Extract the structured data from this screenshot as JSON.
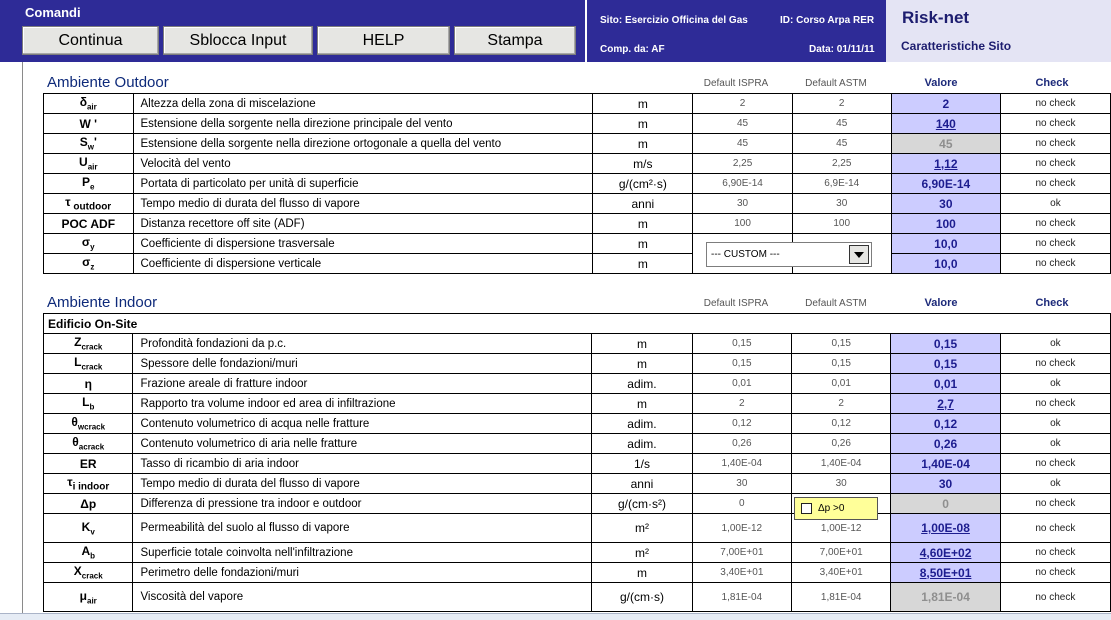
{
  "header": {
    "title": "Comandi",
    "buttons": {
      "continua": "Continua",
      "sblocca": "Sblocca Input",
      "help": "HELP",
      "stampa": "Stampa"
    },
    "site": "Sito: Esercizio Officina del Gas",
    "id": "ID: Corso Arpa RER",
    "comp": "Comp. da: AF",
    "date": "Data: 01/11/11",
    "brand": "Risk-net",
    "subtitle": "Caratteristiche Sito"
  },
  "columns": {
    "isp": "Default ISPRA",
    "astm": "Default ASTM",
    "val": "Valore",
    "chk": "Check"
  },
  "outdoor": {
    "title": "Ambiente Outdoor",
    "rows": [
      {
        "sym": "δair",
        "desc": "Altezza della zona di miscelazione",
        "unit": "m",
        "isp": "2",
        "astm": "2",
        "val": "2",
        "chk": "no check"
      },
      {
        "sym": "W '",
        "desc": "Estensione della sorgente nella direzione principale del vento",
        "unit": "m",
        "isp": "45",
        "astm": "45",
        "val": "140",
        "chk": "no check"
      },
      {
        "sym": "Sw'",
        "desc": "Estensione della sorgente nella direzione ortogonale a quella del vento",
        "unit": "m",
        "isp": "45",
        "astm": "45",
        "val": "45",
        "chk": "no check"
      },
      {
        "sym": "Uair",
        "desc": "Velocità del vento",
        "unit": "m/s",
        "isp": "2,25",
        "astm": "2,25",
        "val": "1,12",
        "chk": "no check"
      },
      {
        "sym": "Pe",
        "desc": "Portata di particolato per unità di superficie",
        "unit": "g/(cm²·s)",
        "isp": "6,90E-14",
        "astm": "6,9E-14",
        "val": "6,90E-14",
        "chk": "no check"
      },
      {
        "sym": "τ outdoor",
        "desc": "Tempo medio di durata del flusso di vapore",
        "unit": "anni",
        "isp": "30",
        "astm": "30",
        "val": "30",
        "chk": "ok"
      },
      {
        "sym": "POC ADF",
        "desc": "Distanza recettore off site (ADF)",
        "unit": "m",
        "isp": "100",
        "astm": "100",
        "val": "100",
        "chk": "no check"
      },
      {
        "sym": "σy",
        "desc": "Coefficiente di dispersione trasversale",
        "unit": "m",
        "isp": "",
        "astm": "",
        "val": "10,0",
        "chk": "no check"
      },
      {
        "sym": "σz",
        "desc": "Coefficiente di dispersione verticale",
        "unit": "m",
        "isp": "",
        "astm": "",
        "val": "10,0",
        "chk": "no check"
      }
    ],
    "dropdown": "--- CUSTOM ---"
  },
  "indoor": {
    "title": "Ambiente Indoor",
    "subheader": "Edificio On-Site",
    "rows": [
      {
        "sym": "Zcrack",
        "desc": "Profondità fondazioni da p.c.",
        "unit": "m",
        "isp": "0,15",
        "astm": "0,15",
        "val": "0,15",
        "chk": "ok"
      },
      {
        "sym": "Lcrack",
        "desc": "Spessore delle fondazioni/muri",
        "unit": "m",
        "isp": "0,15",
        "astm": "0,15",
        "val": "0,15",
        "chk": "no check"
      },
      {
        "sym": "η",
        "desc": "Frazione areale di fratture indoor",
        "unit": "adim.",
        "isp": "0,01",
        "astm": "0,01",
        "val": "0,01",
        "chk": "ok"
      },
      {
        "sym": "Lb",
        "desc": "Rapporto tra volume indoor ed area di infiltrazione",
        "unit": "m",
        "isp": "2",
        "astm": "2",
        "val": "2,7",
        "chk": "no check"
      },
      {
        "sym": "θwcrack",
        "desc": "Contenuto volumetrico di acqua nelle fratture",
        "unit": "adim.",
        "isp": "0,12",
        "astm": "0,12",
        "val": "0,12",
        "chk": "ok"
      },
      {
        "sym": "θacrack",
        "desc": "Contenuto volumetrico di aria nelle fratture",
        "unit": "adim.",
        "isp": "0,26",
        "astm": "0,26",
        "val": "0,26",
        "chk": "ok"
      },
      {
        "sym": "ER",
        "desc": "Tasso di ricambio di aria indoor",
        "unit": "1/s",
        "isp": "1,40E-04",
        "astm": "1,40E-04",
        "val": "1,40E-04",
        "chk": "no check"
      },
      {
        "sym": "τi indoor",
        "desc": "Tempo medio di durata del flusso di vapore",
        "unit": "anni",
        "isp": "30",
        "astm": "30",
        "val": "30",
        "chk": "ok"
      },
      {
        "sym": "Δp",
        "desc": "Differenza di pressione tra indoor e outdoor",
        "unit": "g/(cm·s²)",
        "isp": "0",
        "astm": "",
        "val": "0",
        "chk": "no check"
      },
      {
        "sym": "Kv",
        "desc": "Permeabilità del suolo al flusso di vapore",
        "unit": "m²",
        "isp": "1,00E-12",
        "astm": "1,00E-12",
        "val": "1,00E-08",
        "chk": "no check"
      },
      {
        "sym": "Ab",
        "desc": "Superficie totale coinvolta nell'infiltrazione",
        "unit": "m²",
        "isp": "7,00E+01",
        "astm": "7,00E+01",
        "val": "4,60E+02",
        "chk": "no check"
      },
      {
        "sym": "Xcrack",
        "desc": "Perimetro delle fondazioni/muri",
        "unit": "m",
        "isp": "3,40E+01",
        "astm": "3,40E+01",
        "val": "8,50E+01",
        "chk": "no check"
      },
      {
        "sym": "μair",
        "desc": "Viscosità del vapore",
        "unit": "g/(cm·s)",
        "isp": "1,81E-04",
        "astm": "1,81E-04",
        "val": "1,81E-04",
        "chk": "no check"
      }
    ],
    "checkbox_label": "Δp >0"
  }
}
